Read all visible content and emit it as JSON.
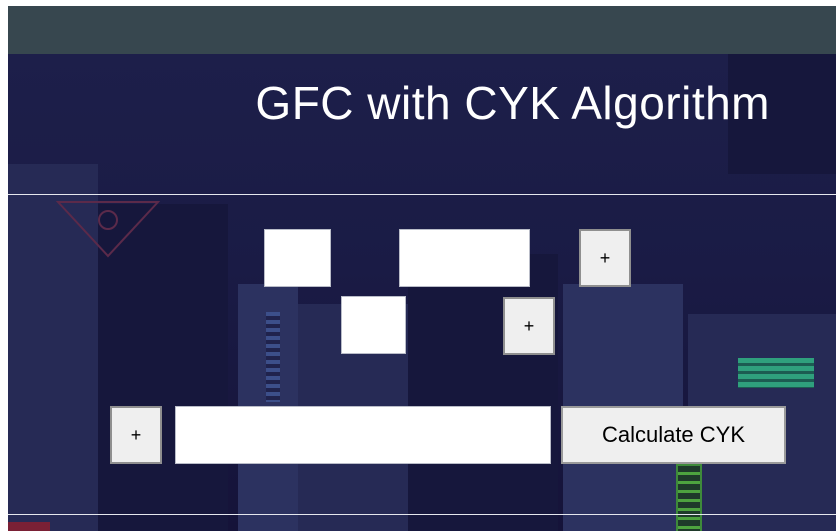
{
  "header": {
    "title": "GFC with CYK Algorithm"
  },
  "grammar_row_1": {
    "add_label": "+"
  },
  "grammar_row_2": {
    "add_label": "+"
  },
  "cyk_row": {
    "add_label": "+",
    "calculate_label": "Calculate CYK"
  },
  "colors": {
    "topbar": "#37474f",
    "background": "#1a1b45",
    "title_text": "#ffffff",
    "accent_green": "#2fa07d",
    "accent_red": "#7a2035"
  }
}
